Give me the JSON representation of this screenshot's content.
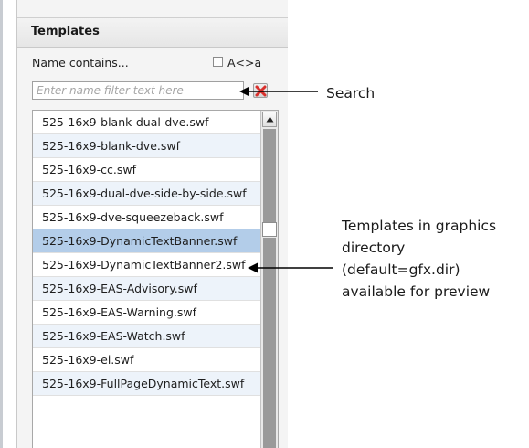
{
  "panel": {
    "title": "Templates",
    "name_contains_label": "Name contains...",
    "case_checkbox_label": "A<>a",
    "case_checkbox_checked": false,
    "filter_placeholder": "Enter name filter text here",
    "filter_value": ""
  },
  "templates": [
    {
      "name": "525-16x9-blank-dual-dve.swf",
      "selected": false
    },
    {
      "name": "525-16x9-blank-dve.swf",
      "selected": false
    },
    {
      "name": "525-16x9-cc.swf",
      "selected": false
    },
    {
      "name": "525-16x9-dual-dve-side-by-side.swf",
      "selected": false
    },
    {
      "name": "525-16x9-dve-squeezeback.swf",
      "selected": false
    },
    {
      "name": "525-16x9-DynamicTextBanner.swf",
      "selected": true
    },
    {
      "name": "525-16x9-DynamicTextBanner2.swf",
      "selected": false
    },
    {
      "name": "525-16x9-EAS-Advisory.swf",
      "selected": false
    },
    {
      "name": "525-16x9-EAS-Warning.swf",
      "selected": false
    },
    {
      "name": "525-16x9-EAS-Watch.swf",
      "selected": false
    },
    {
      "name": "525-16x9-ei.swf",
      "selected": false
    },
    {
      "name": "525-16x9-FullPageDynamicText.swf",
      "selected": false
    }
  ],
  "annotations": {
    "search": "Search",
    "templates_lines": [
      "Templates in graphics",
      "directory",
      "(default=gfx.dir)",
      "available for preview"
    ]
  },
  "icons": {
    "clear": "close-icon",
    "scroll_up": "chevron-up-icon",
    "clear_icon_color": "#d9302c"
  }
}
